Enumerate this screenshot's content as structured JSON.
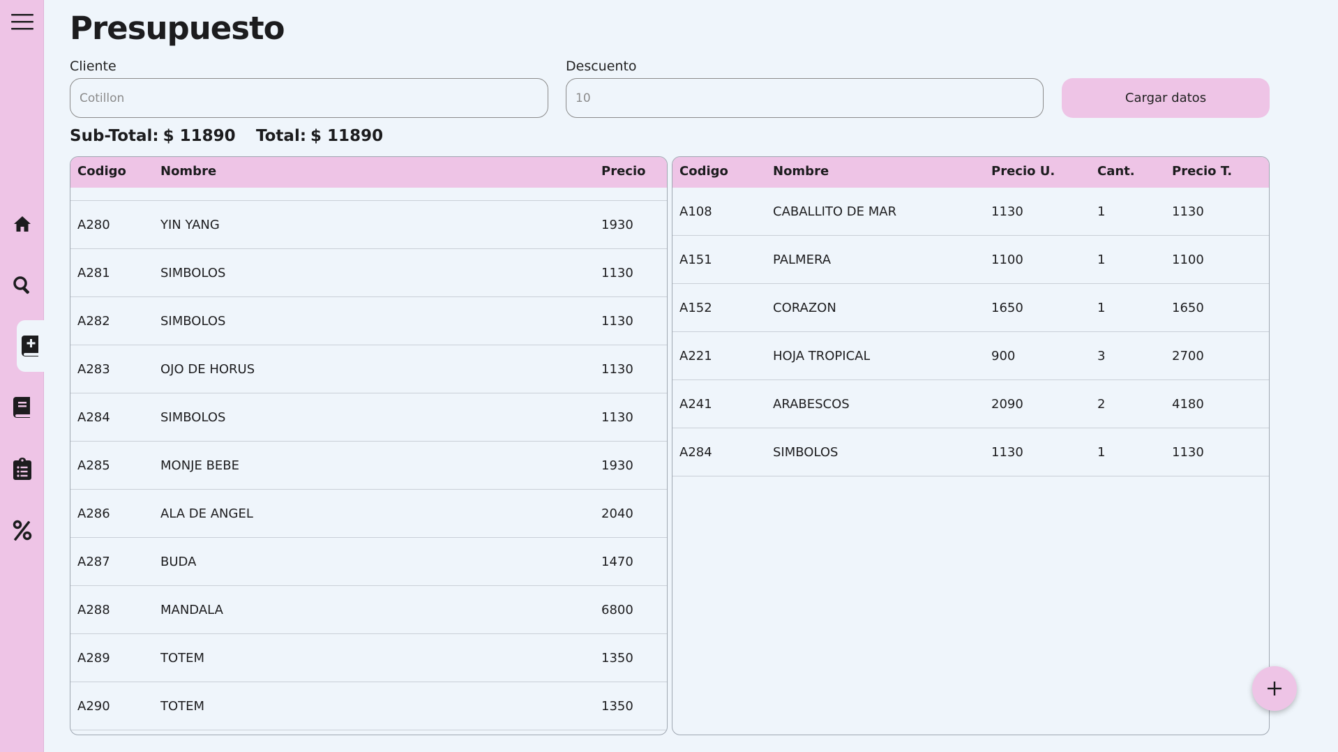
{
  "page": {
    "title": "Presupuesto"
  },
  "sidebar": {
    "items": [
      {
        "name": "menu-icon"
      },
      {
        "name": "home-icon"
      },
      {
        "name": "search-icon"
      },
      {
        "name": "add-book-icon",
        "active": true
      },
      {
        "name": "book-icon"
      },
      {
        "name": "clipboard-icon"
      },
      {
        "name": "percent-icon"
      }
    ]
  },
  "form": {
    "cliente_label": "Cliente",
    "cliente_placeholder": "Cotillon",
    "descuento_label": "Descuento",
    "descuento_placeholder": "10",
    "load_button": "Cargar datos"
  },
  "totals": {
    "subtotal_label": "Sub-Total:",
    "subtotal_value": "$ 11890",
    "total_label": "Total:",
    "total_value": "$ 11890"
  },
  "catalog": {
    "headers": [
      "Codigo",
      "Nombre",
      "Precio"
    ],
    "rows": [
      [
        "A280",
        "YIN YANG",
        "1930"
      ],
      [
        "A281",
        "SIMBOLOS",
        "1130"
      ],
      [
        "A282",
        "SIMBOLOS",
        "1130"
      ],
      [
        "A283",
        "OJO DE HORUS",
        "1130"
      ],
      [
        "A284",
        "SIMBOLOS",
        "1130"
      ],
      [
        "A285",
        "MONJE BEBE",
        "1930"
      ],
      [
        "A286",
        "ALA DE ANGEL",
        "2040"
      ],
      [
        "A287",
        "BUDA",
        "1470"
      ],
      [
        "A288",
        "MANDALA",
        "6800"
      ],
      [
        "A289",
        "TOTEM",
        "1350"
      ],
      [
        "A290",
        "TOTEM",
        "1350"
      ]
    ]
  },
  "budget": {
    "headers": [
      "Codigo",
      "Nombre",
      "Precio U.",
      "Cant.",
      "Precio T."
    ],
    "rows": [
      [
        "A108",
        "CABALLITO DE MAR",
        "1130",
        "1",
        "1130"
      ],
      [
        "A151",
        "PALMERA",
        "1100",
        "1",
        "1100"
      ],
      [
        "A152",
        "CORAZON",
        "1650",
        "1",
        "1650"
      ],
      [
        "A221",
        "HOJA TROPICAL",
        "900",
        "3",
        "2700"
      ],
      [
        "A241",
        "ARABESCOS",
        "2090",
        "2",
        "4180"
      ],
      [
        "A284",
        "SIMBOLOS",
        "1130",
        "1",
        "1130"
      ]
    ]
  },
  "fab": {
    "icon": "plus-icon"
  },
  "colors": {
    "accent": "#eec4e6",
    "background": "#eff5fb",
    "text": "#1c1c1e"
  }
}
